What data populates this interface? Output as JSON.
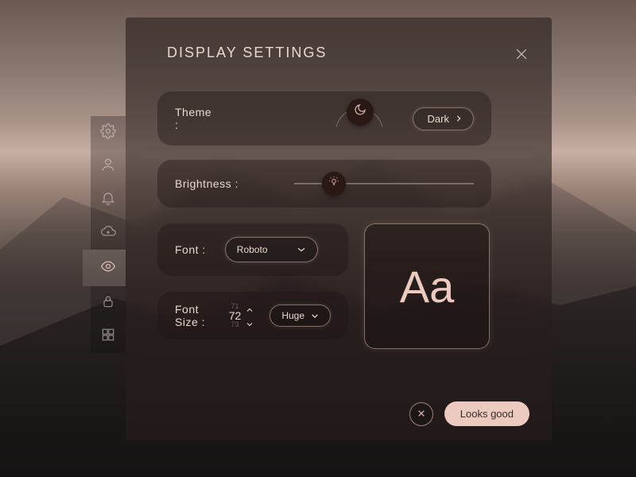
{
  "dialog": {
    "title": "DISPLAY SETTINGS",
    "theme": {
      "label": "Theme :",
      "value": "Dark"
    },
    "brightness": {
      "label": "Brightness :",
      "percent": 22
    },
    "font": {
      "label": "Font :",
      "value": "Roboto"
    },
    "fontSize": {
      "label": "Font Size :",
      "prev": "71",
      "value": "72",
      "next": "73",
      "preset": "Huge"
    },
    "preview": "Aa",
    "cancel_label": "X",
    "confirm_label": "Looks good"
  },
  "sidebar": {
    "items": [
      {
        "name": "settings"
      },
      {
        "name": "profile"
      },
      {
        "name": "notifications"
      },
      {
        "name": "cloud-upload"
      },
      {
        "name": "display",
        "active": true
      },
      {
        "name": "security"
      },
      {
        "name": "layout"
      }
    ]
  },
  "colors": {
    "accent": "#eccac0",
    "knob": "#2a1815"
  }
}
